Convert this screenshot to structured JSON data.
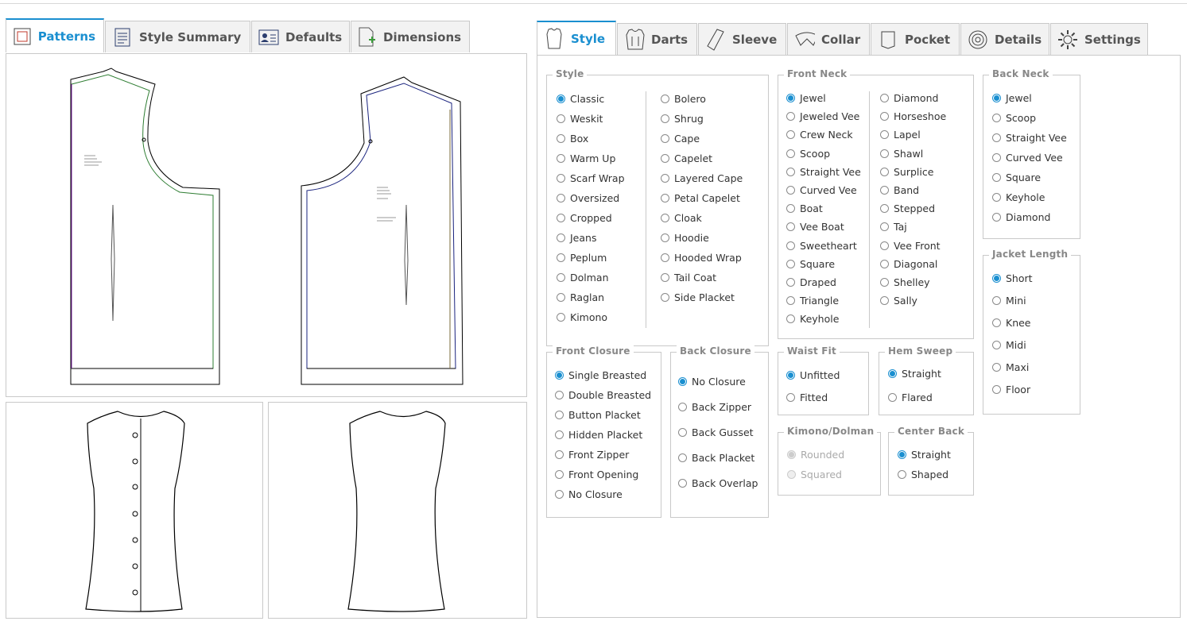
{
  "left_tabs": [
    {
      "label": "Patterns",
      "icon": "patterns-icon",
      "active": true
    },
    {
      "label": "Style Summary",
      "icon": "document-icon",
      "active": false
    },
    {
      "label": "Defaults",
      "icon": "user-card-icon",
      "active": false
    },
    {
      "label": "Dimensions",
      "icon": "add-document-icon",
      "active": false
    }
  ],
  "right_tabs": [
    {
      "label": "Style",
      "icon": "shirt-icon",
      "active": true
    },
    {
      "label": "Darts",
      "icon": "darts-icon",
      "active": false
    },
    {
      "label": "Sleeve",
      "icon": "sleeve-icon",
      "active": false
    },
    {
      "label": "Collar",
      "icon": "collar-icon",
      "active": false
    },
    {
      "label": "Pocket",
      "icon": "pocket-icon",
      "active": false
    },
    {
      "label": "Details",
      "icon": "details-icon",
      "active": false
    },
    {
      "label": "Settings",
      "icon": "gear-icon",
      "active": false
    }
  ],
  "groups": {
    "style": {
      "legend": "Style",
      "selected": "Classic",
      "col1": [
        "Classic",
        "Weskit",
        "Box",
        "Warm Up",
        "Scarf Wrap",
        "Oversized",
        "Cropped",
        "Jeans",
        "Peplum",
        "Dolman",
        "Raglan",
        "Kimono"
      ],
      "col2": [
        "Bolero",
        "Shrug",
        "Cape",
        "Capelet",
        "Layered Cape",
        "Petal Capelet",
        "Cloak",
        "Hoodie",
        "Hooded Wrap",
        "Tail Coat",
        "Side Placket"
      ]
    },
    "front_neck": {
      "legend": "Front Neck",
      "selected": "Jewel",
      "col1": [
        "Jewel",
        "Jeweled Vee",
        "Crew Neck",
        "Scoop",
        "Straight Vee",
        "Curved Vee",
        "Boat",
        "Vee Boat",
        "Sweetheart",
        "Square",
        "Draped",
        "Triangle",
        "Keyhole"
      ],
      "col2": [
        "Diamond",
        "Horseshoe",
        "Lapel",
        "Shawl",
        "Surplice",
        "Band",
        "Stepped",
        "Taj",
        "Vee Front",
        "Diagonal",
        "Shelley",
        "Sally"
      ]
    },
    "back_neck": {
      "legend": "Back Neck",
      "selected": "Jewel",
      "col1": [
        "Jewel",
        "Scoop",
        "Straight Vee",
        "Curved Vee",
        "Square",
        "Keyhole",
        "Diamond"
      ]
    },
    "jacket_length": {
      "legend": "Jacket Length",
      "selected": "Short",
      "col1": [
        "Short",
        "Mini",
        "Knee",
        "Midi",
        "Maxi",
        "Floor"
      ]
    },
    "front_closure": {
      "legend": "Front Closure",
      "selected": "Single Breasted",
      "col1": [
        "Single Breasted",
        "Double Breasted",
        "Button Placket",
        "Hidden Placket",
        "Front Zipper",
        "Front Opening",
        "No Closure"
      ]
    },
    "back_closure": {
      "legend": "Back Closure",
      "selected": "No Closure",
      "col1": [
        "No Closure",
        "Back Zipper",
        "Back Gusset",
        "Back Placket",
        "Back Overlap"
      ]
    },
    "waist_fit": {
      "legend": "Waist Fit",
      "selected": "Unfitted",
      "col1": [
        "Unfitted",
        "Fitted"
      ]
    },
    "hem_sweep": {
      "legend": "Hem Sweep",
      "selected": "Straight",
      "col1": [
        "Straight",
        "Flared"
      ]
    },
    "kimono_dolman": {
      "legend": "Kimono/Dolman",
      "selected": "Rounded",
      "disabled": true,
      "col1": [
        "Rounded",
        "Squared"
      ]
    },
    "center_back": {
      "legend": "Center Back",
      "selected": "Straight",
      "col1": [
        "Straight",
        "Shaped"
      ]
    }
  },
  "colors": {
    "accent": "#1a8fd0",
    "border": "#c9c9c9",
    "front_seam": "#2e7d32",
    "back_seam": "#1a237e"
  }
}
